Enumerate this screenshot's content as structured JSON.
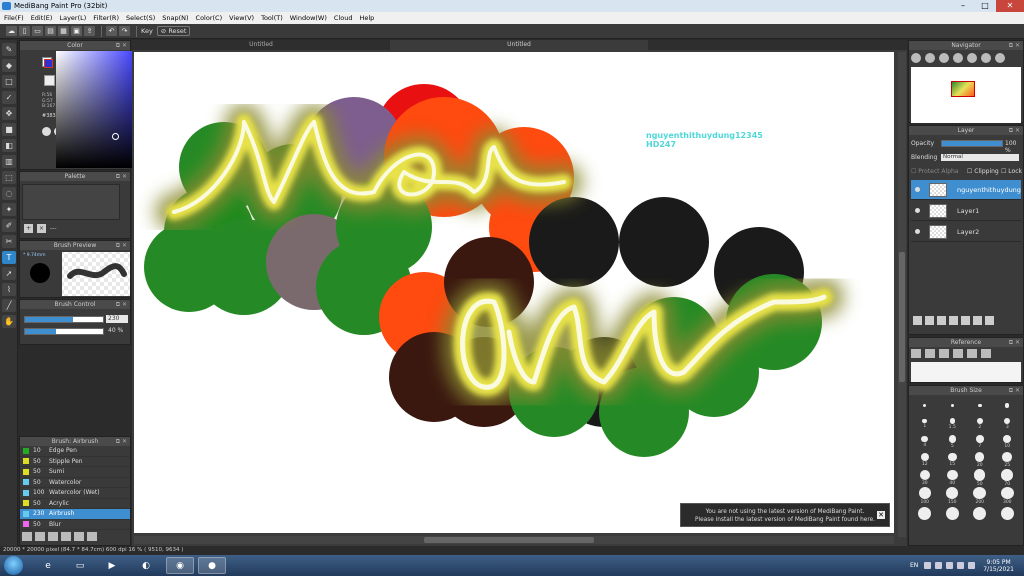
{
  "window": {
    "title": "MediBang Paint Pro (32bit)"
  },
  "menu": [
    "File(F)",
    "Edit(E)",
    "Layer(L)",
    "Filter(R)",
    "Select(S)",
    "Snap(N)",
    "Color(C)",
    "View(V)",
    "Tool(T)",
    "Window(W)",
    "Cloud",
    "Help"
  ],
  "toolbar": {
    "key_label": "Key",
    "reset_label": "Reset"
  },
  "color_panel": {
    "title": "Color",
    "rgb": [
      "R:56",
      "G:57",
      "B:167"
    ],
    "hex": "#3839D0",
    "current_color": "#3839D0"
  },
  "palette_panel": {
    "title": "Palette",
    "more": "---"
  },
  "brush_preview": {
    "title": "Brush Preview",
    "size": "9.74mm"
  },
  "brush_control": {
    "title": "Brush Control",
    "size_value": "230",
    "size_fill": 0.62,
    "opacity_value": "40 %",
    "opacity_fill": 0.4
  },
  "brush_list": {
    "title": "Brush: Airbrush",
    "items": [
      {
        "size": "10",
        "name": "Edge Pen",
        "color": "#22aa22",
        "active": false
      },
      {
        "size": "50",
        "name": "Stipple Pen",
        "color": "#dddd22",
        "active": false
      },
      {
        "size": "50",
        "name": "Sumi",
        "color": "#dddd22",
        "active": false
      },
      {
        "size": "50",
        "name": "Watercolor",
        "color": "#66ccee",
        "active": false
      },
      {
        "size": "100",
        "name": "Watercolor (Wet)",
        "color": "#66ccee",
        "active": false
      },
      {
        "size": "50",
        "name": "Acrylic",
        "color": "#dddd22",
        "active": false
      },
      {
        "size": "230",
        "name": "Airbrush",
        "color": "#66ccee",
        "active": true
      },
      {
        "size": "50",
        "name": "Blur",
        "color": "#ee66ee",
        "active": false
      }
    ]
  },
  "canvas_tabs": [
    "Untitled",
    "Untitled"
  ],
  "canvas": {
    "watermark_lines": [
      "nguyenthithuydung12345",
      "HD247"
    ],
    "watermark_color": "#4fd8d8"
  },
  "notice": {
    "lines": [
      "You are not using the latest version of MediBang Paint.",
      "Please install the latest version of MediBang Paint found here."
    ]
  },
  "navigator": {
    "title": "Navigator"
  },
  "layer_panel": {
    "title": "Layer",
    "opacity_label": "Opacity",
    "opacity_value": "100 %",
    "blending_label": "Blending",
    "blending_value": "Normal",
    "protect_alpha": "Protect Alpha",
    "clipping": "Clipping",
    "lock": "Lock",
    "layers": [
      {
        "name": "nguyenthithuydung",
        "active": true
      },
      {
        "name": "Layer1",
        "active": false
      },
      {
        "name": "Layer2",
        "active": false
      }
    ]
  },
  "reference": {
    "title": "Reference"
  },
  "brush_size": {
    "title": "Brush Size",
    "sizes": [
      "",
      "",
      "",
      "",
      "1",
      "1.5",
      "2",
      "3",
      "4",
      "5",
      "7",
      "10",
      "12",
      "15",
      "20",
      "25",
      "30",
      "40",
      "50",
      "70",
      "100",
      "150",
      "200",
      "300",
      "",
      "",
      "",
      ""
    ]
  },
  "statusbar": "20000 * 20000 pixel  (84.7 * 84.7cm)  600 dpi  16 %  ( 9510, 9634 )",
  "taskbar": {
    "lang": "EN",
    "time": "9:05 PM",
    "date": "7/15/2021"
  }
}
